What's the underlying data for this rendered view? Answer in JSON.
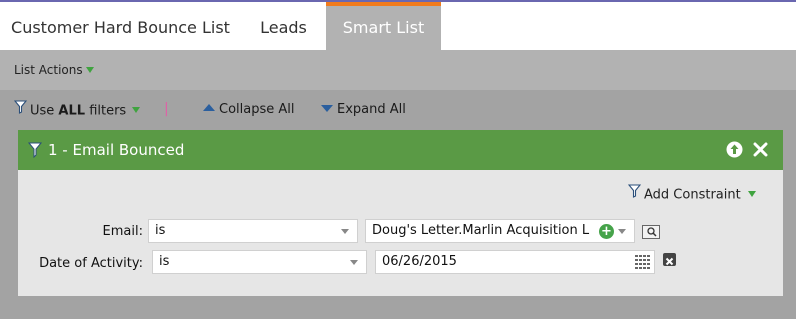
{
  "tabs": [
    {
      "label": "Customer Hard Bounce List",
      "active": false
    },
    {
      "label": "Leads",
      "active": false
    },
    {
      "label": "Smart List",
      "active": true
    }
  ],
  "actions": {
    "list_actions": "List Actions"
  },
  "toolbar": {
    "use_prefix": "Use ",
    "use_bold": "ALL",
    "use_suffix": " filters",
    "separator": "|",
    "collapse_all": "Collapse All",
    "expand_all": "Expand All"
  },
  "filter": {
    "title": "1 - Email Bounced",
    "add_constraint": "Add Constraint",
    "rows": [
      {
        "label": "Email:",
        "operator": "is",
        "value": "Doug's Letter.Marlin Acquisition L"
      },
      {
        "label": "Date of Activity:",
        "operator": "is",
        "value": "06/26/2015"
      }
    ]
  },
  "colors": {
    "accent_orange": "#f17b1c",
    "filter_green": "#5a9a45",
    "link_blue": "#2b5f9e"
  }
}
